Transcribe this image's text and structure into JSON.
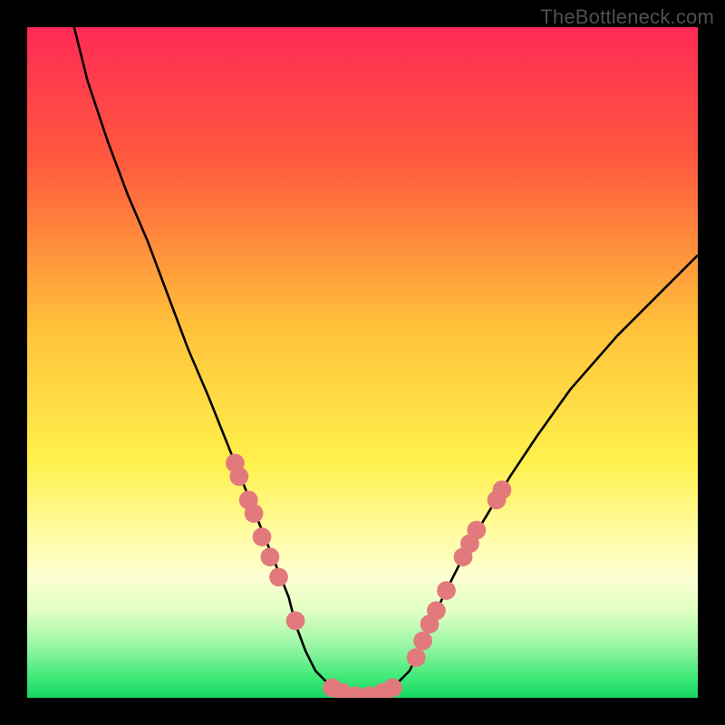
{
  "watermark": "TheBottleneck.com",
  "chart_data": {
    "type": "line",
    "title": "",
    "xlabel": "",
    "ylabel": "",
    "xlim": [
      0,
      100
    ],
    "ylim": [
      0,
      100
    ],
    "background_gradient_stops": [
      {
        "pos": 0,
        "color": "#ff2a55"
      },
      {
        "pos": 20,
        "color": "#ff5a3e"
      },
      {
        "pos": 45,
        "color": "#ffc23a"
      },
      {
        "pos": 65,
        "color": "#fff14d"
      },
      {
        "pos": 76,
        "color": "#fffca6"
      },
      {
        "pos": 82,
        "color": "#fdffd2"
      },
      {
        "pos": 87,
        "color": "#e2ffc4"
      },
      {
        "pos": 92,
        "color": "#9cf7a6"
      },
      {
        "pos": 97,
        "color": "#3fe978"
      },
      {
        "pos": 100,
        "color": "#17d561"
      }
    ],
    "series": [
      {
        "name": "bottleneck-curve",
        "color": "#000000",
        "x": [
          7,
          9,
          12,
          15,
          18,
          21,
          24,
          27,
          29,
          31,
          33,
          35,
          37,
          39,
          40,
          41.5,
          43,
          46,
          50,
          54,
          57,
          58.5,
          60,
          62,
          64,
          66,
          69,
          72,
          76,
          81,
          88,
          100
        ],
        "y": [
          100,
          92,
          83,
          75,
          68,
          60,
          52,
          45,
          40,
          35,
          30,
          25,
          20,
          15,
          11,
          7,
          4,
          1,
          0,
          1,
          4,
          7,
          11,
          15,
          19,
          23,
          28,
          33,
          39,
          46,
          54,
          66
        ]
      }
    ],
    "markers": {
      "name": "highlight-dots",
      "color": "#e27a7d",
      "radius": 1.4,
      "points": [
        {
          "x": 31.0,
          "y": 35.0
        },
        {
          "x": 31.6,
          "y": 33.0
        },
        {
          "x": 33.0,
          "y": 29.5
        },
        {
          "x": 33.8,
          "y": 27.5
        },
        {
          "x": 35.0,
          "y": 24.0
        },
        {
          "x": 36.2,
          "y": 21.0
        },
        {
          "x": 37.5,
          "y": 18.0
        },
        {
          "x": 40.0,
          "y": 11.5
        },
        {
          "x": 45.5,
          "y": 1.5
        },
        {
          "x": 47.0,
          "y": 0.8
        },
        {
          "x": 49.0,
          "y": 0.3
        },
        {
          "x": 51.0,
          "y": 0.3
        },
        {
          "x": 53.0,
          "y": 0.8
        },
        {
          "x": 54.5,
          "y": 1.5
        },
        {
          "x": 58.0,
          "y": 6.0
        },
        {
          "x": 59.0,
          "y": 8.5
        },
        {
          "x": 60.0,
          "y": 11.0
        },
        {
          "x": 61.0,
          "y": 13.0
        },
        {
          "x": 62.5,
          "y": 16.0
        },
        {
          "x": 65.0,
          "y": 21.0
        },
        {
          "x": 66.0,
          "y": 23.0
        },
        {
          "x": 67.0,
          "y": 25.0
        },
        {
          "x": 70.0,
          "y": 29.5
        },
        {
          "x": 70.8,
          "y": 31.0
        }
      ]
    }
  }
}
